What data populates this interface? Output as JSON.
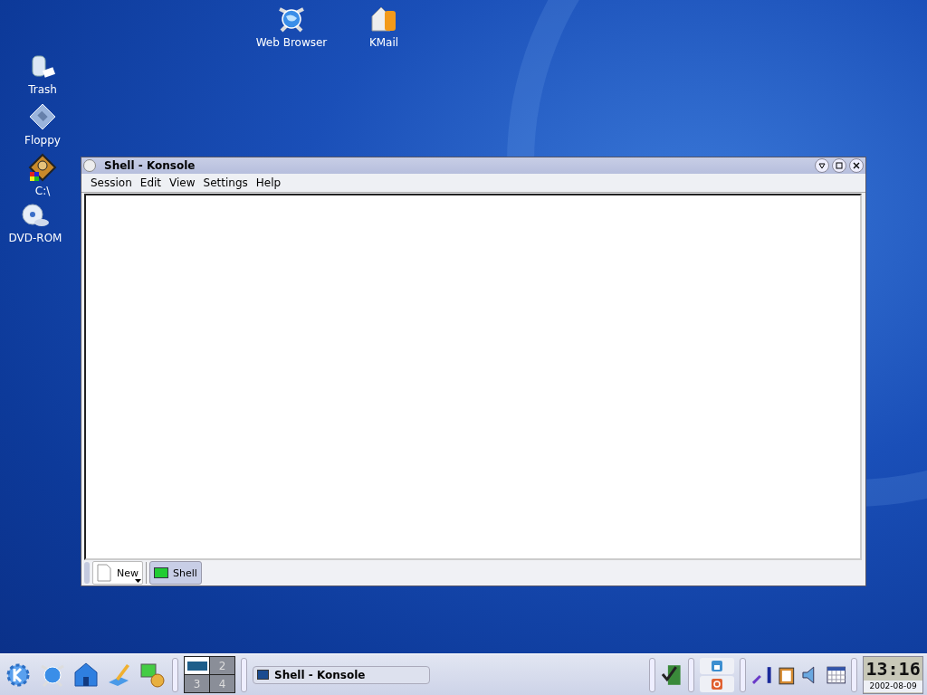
{
  "desktop_icons": [
    {
      "label": "Web Browser",
      "kind": "globe"
    },
    {
      "label": "KMail",
      "kind": "mail"
    },
    {
      "label": "Trash",
      "kind": "trash"
    },
    {
      "label": "Floppy",
      "kind": "floppy"
    },
    {
      "label": "C:\\",
      "kind": "disk"
    },
    {
      "label": "DVD-ROM",
      "kind": "dvd"
    }
  ],
  "window": {
    "title": "Shell - Konsole",
    "menu": [
      "Session",
      "Edit",
      "View",
      "Settings",
      "Help"
    ],
    "tabs": [
      {
        "label": "Shell",
        "selected": true
      }
    ],
    "new_button": "New"
  },
  "taskbar": {
    "pager": [
      {
        "selected": true
      },
      {
        "label": "2",
        "selected": false
      },
      {
        "label": "3",
        "selected": false
      },
      {
        "label": "4",
        "selected": false
      }
    ],
    "tasks": [
      {
        "title": "Shell - Konsole"
      }
    ],
    "clock": {
      "time": "13:16",
      "date": "2002-08-09"
    }
  }
}
